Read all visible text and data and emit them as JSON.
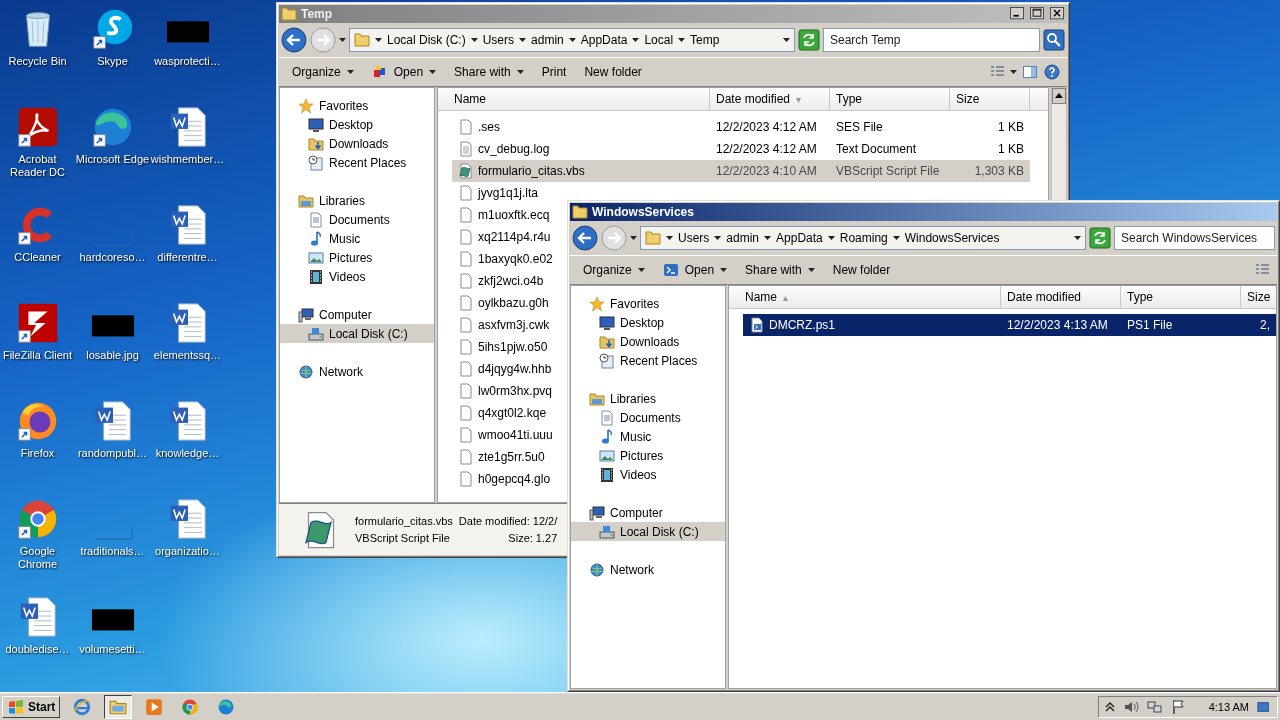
{
  "desktop_icons": [
    {
      "label": "Recycle Bin",
      "kind": "recycle",
      "shortcut": false
    },
    {
      "label": "Acrobat Reader DC",
      "kind": "acrobat",
      "shortcut": true
    },
    {
      "label": "CCleaner",
      "kind": "ccleaner",
      "shortcut": true
    },
    {
      "label": "FileZilla Client",
      "kind": "filezilla",
      "shortcut": true
    },
    {
      "label": "Firefox",
      "kind": "firefox",
      "shortcut": true
    },
    {
      "label": "Google Chrome",
      "kind": "chrome",
      "shortcut": true
    },
    {
      "label": "doubledise…",
      "kind": "word",
      "shortcut": false
    },
    {
      "label": "Skype",
      "kind": "skype",
      "shortcut": true
    },
    {
      "label": "Microsoft Edge",
      "kind": "edge",
      "shortcut": true
    },
    {
      "label": "hardcoreso…",
      "kind": "thumb",
      "shortcut": false
    },
    {
      "label": "losable.jpg",
      "kind": "redacted",
      "shortcut": false
    },
    {
      "label": "randompubl…",
      "kind": "word",
      "shortcut": false
    },
    {
      "label": "traditionals…",
      "kind": "thumb",
      "shortcut": false
    },
    {
      "label": "volumesetti…",
      "kind": "redacted",
      "shortcut": false
    },
    {
      "label": "wasprotecti…",
      "kind": "redacted",
      "shortcut": false
    },
    {
      "label": "wishmember…",
      "kind": "word",
      "shortcut": false
    },
    {
      "label": "differentre…",
      "kind": "word",
      "shortcut": false
    },
    {
      "label": "elementssq…",
      "kind": "word",
      "shortcut": false
    },
    {
      "label": "knowledge…",
      "kind": "word",
      "shortcut": false
    },
    {
      "label": "organizatio…",
      "kind": "word",
      "shortcut": false
    }
  ],
  "windows": [
    {
      "title": "Temp",
      "active": false,
      "breadcrumb": [
        "Local Disk (C:)",
        "Users",
        "admin",
        "AppData",
        "Local",
        "Temp"
      ],
      "search": {
        "placeholder": "Search Temp"
      },
      "toolbar": [
        {
          "label": "Organize",
          "kind": "menu"
        },
        {
          "label": "Open",
          "kind": "open-app"
        },
        {
          "label": "Share with",
          "kind": "menu"
        },
        {
          "label": "Print",
          "kind": "plain"
        },
        {
          "label": "New folder",
          "kind": "plain"
        }
      ],
      "nav": [
        {
          "label": "Favorites",
          "kind": "favorites",
          "selected": false,
          "children": [
            {
              "label": "Desktop",
              "kind": "desktop",
              "selected": false
            },
            {
              "label": "Downloads",
              "kind": "downloads",
              "selected": false
            },
            {
              "label": "Recent Places",
              "kind": "recent",
              "selected": false
            }
          ]
        },
        {
          "label": "Libraries",
          "kind": "libraries",
          "selected": false,
          "children": [
            {
              "label": "Documents",
              "kind": "documents",
              "selected": false
            },
            {
              "label": "Music",
              "kind": "music",
              "selected": false
            },
            {
              "label": "Pictures",
              "kind": "pictures",
              "selected": false
            },
            {
              "label": "Videos",
              "kind": "videos",
              "selected": false
            }
          ]
        },
        {
          "label": "Computer",
          "kind": "computer",
          "selected": false,
          "children": [
            {
              "label": "Local Disk (C:)",
              "kind": "disk",
              "selected": true
            }
          ]
        },
        {
          "label": "Network",
          "kind": "network",
          "selected": false
        }
      ],
      "columns": [
        {
          "label": "Name"
        },
        {
          "label": "Date modified",
          "sort_mark": "▾"
        },
        {
          "label": "Type"
        },
        {
          "label": "Size"
        }
      ],
      "rows": [
        {
          "name": ".ses",
          "kind": "blank",
          "date": "12/2/2023 4:12 AM",
          "type": "SES File",
          "size": "1 KB",
          "selected": false
        },
        {
          "name": "cv_debug.log",
          "kind": "text",
          "date": "12/2/2023 4:12 AM",
          "type": "Text Document",
          "size": "1 KB",
          "selected": false
        },
        {
          "name": "formulario_citas.vbs",
          "kind": "script",
          "date": "12/2/2023 4:10 AM",
          "type": "VBScript Script File",
          "size": "1,303 KB",
          "selected": true
        },
        {
          "name": "jyvg1q1j.lta",
          "kind": "blank",
          "selected": false
        },
        {
          "name": "m1uoxftk.ecq",
          "kind": "blank",
          "selected": false
        },
        {
          "name": "xq2114p4.r4u",
          "kind": "blank",
          "selected": false
        },
        {
          "name": "1baxyqk0.e02",
          "kind": "blank",
          "selected": false
        },
        {
          "name": "zkfj2wci.o4b",
          "kind": "blank",
          "selected": false
        },
        {
          "name": "oylkbazu.g0h",
          "kind": "blank",
          "selected": false
        },
        {
          "name": "asxfvm3j.cwk",
          "kind": "blank",
          "selected": false
        },
        {
          "name": "5ihs1pjw.o50",
          "kind": "blank",
          "selected": false
        },
        {
          "name": "d4jqyg4w.hhb",
          "kind": "blank",
          "selected": false
        },
        {
          "name": "lw0rm3hx.pvq",
          "kind": "blank",
          "selected": false
        },
        {
          "name": "q4xgt0l2.kqe",
          "kind": "blank",
          "selected": false
        },
        {
          "name": "wmoo41ti.uuu",
          "kind": "blank",
          "selected": false
        },
        {
          "name": "zte1g5rr.5u0",
          "kind": "blank",
          "selected": false
        },
        {
          "name": "h0gepcq4.glo",
          "kind": "blank",
          "selected": false
        }
      ],
      "details": {
        "name": "formulario_citas.vbs",
        "date": "Date modified: 12/2/",
        "type": "VBScript Script File",
        "size": "Size: 1.27"
      }
    },
    {
      "title": "WindowsServices",
      "active": true,
      "breadcrumb": [
        "Users",
        "admin",
        "AppData",
        "Roaming",
        "WindowsServices"
      ],
      "search": {
        "placeholder": "Search WindowsServices"
      },
      "toolbar": [
        {
          "label": "Organize",
          "kind": "menu"
        },
        {
          "label": "Open",
          "kind": "open-shell"
        },
        {
          "label": "Share with",
          "kind": "menu"
        },
        {
          "label": "New folder",
          "kind": "plain"
        }
      ],
      "nav": [
        {
          "label": "Favorites",
          "kind": "favorites",
          "selected": false,
          "children": [
            {
              "label": "Desktop",
              "kind": "desktop",
              "selected": false
            },
            {
              "label": "Downloads",
              "kind": "downloads",
              "selected": false
            },
            {
              "label": "Recent Places",
              "kind": "recent",
              "selected": false
            }
          ]
        },
        {
          "label": "Libraries",
          "kind": "libraries",
          "selected": false,
          "children": [
            {
              "label": "Documents",
              "kind": "documents",
              "selected": false
            },
            {
              "label": "Music",
              "kind": "music",
              "selected": false
            },
            {
              "label": "Pictures",
              "kind": "pictures",
              "selected": false
            },
            {
              "label": "Videos",
              "kind": "videos",
              "selected": false
            }
          ]
        },
        {
          "label": "Computer",
          "kind": "computer",
          "selected": false,
          "children": [
            {
              "label": "Local Disk (C:)",
              "kind": "disk",
              "selected": true
            }
          ]
        },
        {
          "label": "Network",
          "kind": "network",
          "selected": false
        }
      ],
      "columns": [
        {
          "label": "Name",
          "sort_mark": "▴"
        },
        {
          "label": "Date modified"
        },
        {
          "label": "Type"
        },
        {
          "label": "Size"
        }
      ],
      "rows": [
        {
          "name": "DMCRZ.ps1",
          "kind": "shell",
          "date": "12/2/2023 4:13 AM",
          "type": "PS1 File",
          "size": "2,",
          "selected": true
        }
      ]
    }
  ],
  "taskbar": {
    "start": "Start",
    "apps": [
      {
        "kind": "ie",
        "selected": false
      },
      {
        "kind": "explorer",
        "selected": true
      },
      {
        "kind": "media",
        "selected": false
      },
      {
        "kind": "chrome",
        "selected": false
      },
      {
        "kind": "edge",
        "selected": false
      }
    ],
    "clock": "4:13 AM"
  }
}
